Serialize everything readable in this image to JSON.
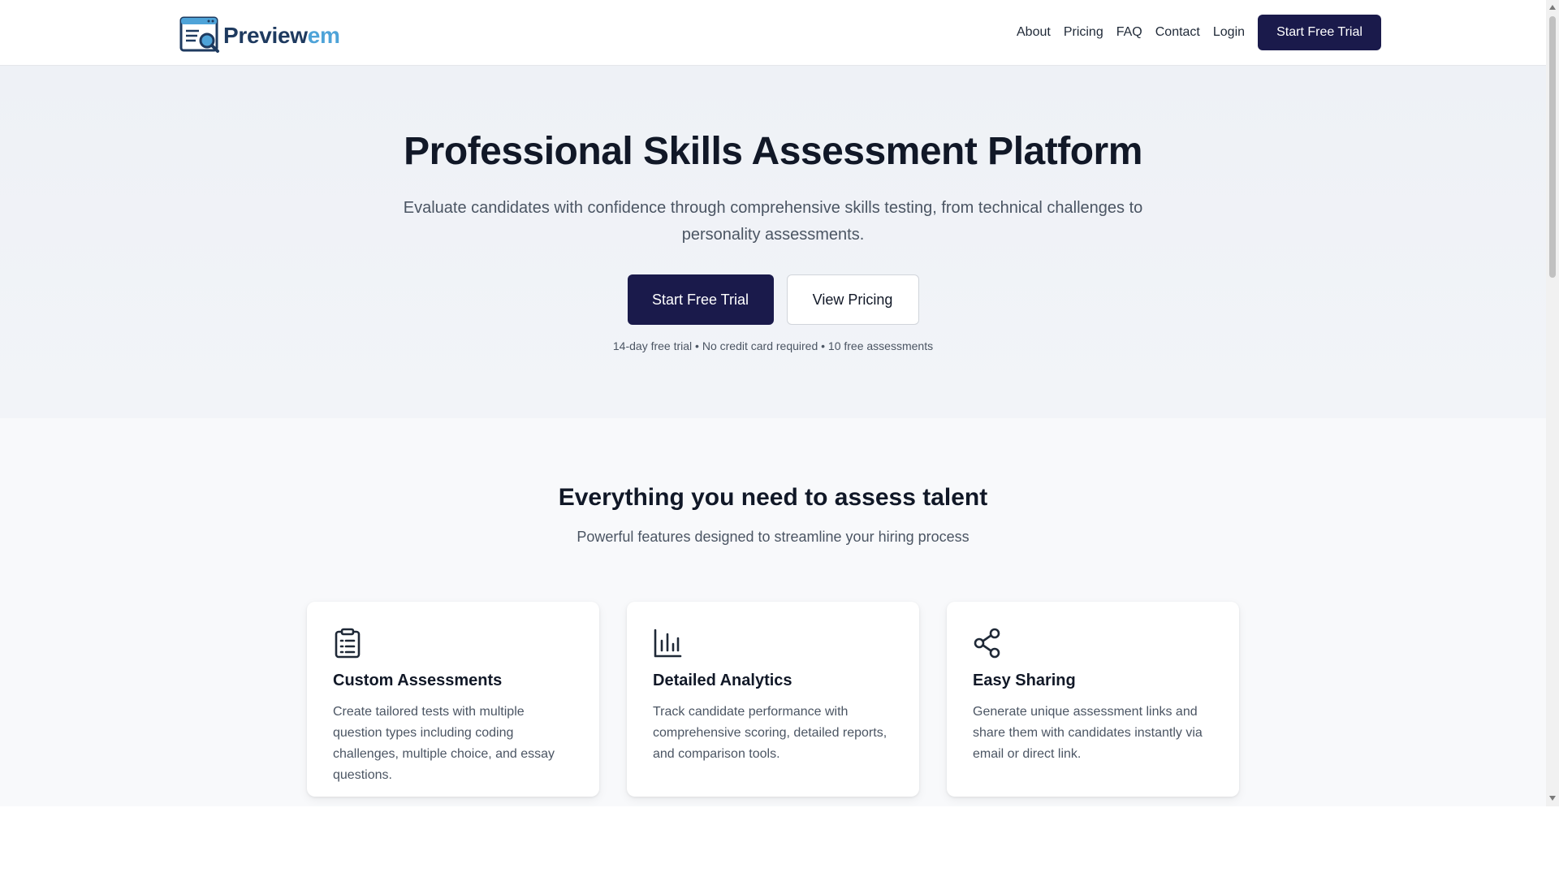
{
  "header": {
    "logo": {
      "text_a": "Preview",
      "text_b": "em",
      "icon": "logo-browser-magnifier-icon"
    },
    "nav": [
      {
        "label": "About"
      },
      {
        "label": "Pricing"
      },
      {
        "label": "FAQ"
      },
      {
        "label": "Contact"
      },
      {
        "label": "Login"
      }
    ],
    "cta_label": "Start Free Trial"
  },
  "hero": {
    "title": "Professional Skills Assessment Platform",
    "subtitle": "Evaluate candidates with confidence through comprehensive skills testing, from technical challenges to personality assessments.",
    "primary_label": "Start Free Trial",
    "secondary_label": "View Pricing",
    "note": "14-day free trial • No credit card required • 10 free assessments"
  },
  "features": {
    "title": "Everything you need to assess talent",
    "subtitle": "Powerful features designed to streamline your hiring process",
    "cards": [
      {
        "icon": "clipboard-list-icon",
        "title": "Custom Assessments",
        "description": "Create tailored tests with multiple question types including coding challenges, multiple choice, and essay questions."
      },
      {
        "icon": "bar-chart-icon",
        "title": "Detailed Analytics",
        "description": "Track candidate performance with comprehensive scoring, detailed reports, and comparison tools."
      },
      {
        "icon": "share-icon",
        "title": "Easy Sharing",
        "description": "Generate unique assessment links and share them with candidates instantly via email or direct link."
      }
    ]
  },
  "colors": {
    "primary": "#1a1a4b",
    "logo_dark": "#1e3a5f",
    "logo_light": "#4ea3d8",
    "text": "#111827",
    "muted": "#4b5563"
  }
}
